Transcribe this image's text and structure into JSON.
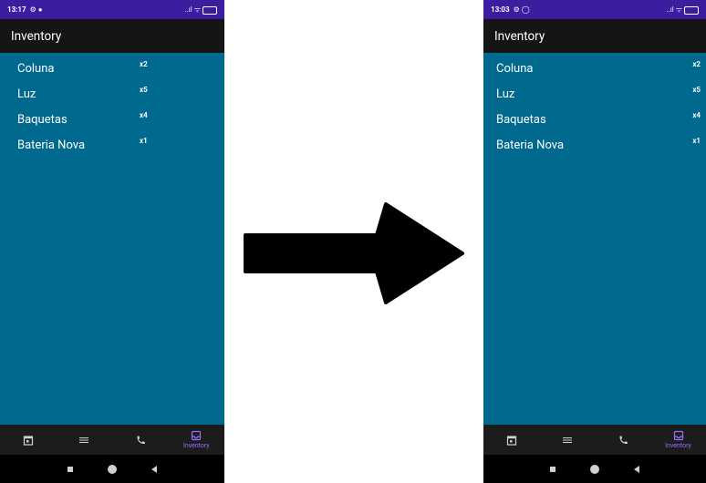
{
  "screens": [
    {
      "status": {
        "time": "13:17",
        "left_icons": "⚙ ●",
        "right_icons": "..ıl ᯤ",
        "battery": "61"
      },
      "title": "Inventory",
      "items": [
        {
          "name": "Coluna",
          "qty": "x2"
        },
        {
          "name": "Luz",
          "qty": "x5"
        },
        {
          "name": "Baquetas",
          "qty": "x4"
        },
        {
          "name": "Bateria Nova",
          "qty": "x1"
        }
      ],
      "nav": {
        "active_label": "Inventory"
      }
    },
    {
      "status": {
        "time": "13:03",
        "left_icons": "⚙ ◯",
        "right_icons": "..ıl ᯤ",
        "battery": "57"
      },
      "title": "Inventory",
      "items": [
        {
          "name": "Coluna",
          "qty": "x2"
        },
        {
          "name": "Luz",
          "qty": "x5"
        },
        {
          "name": "Baquetas",
          "qty": "x4"
        },
        {
          "name": "Bateria Nova",
          "qty": "x1"
        }
      ],
      "nav": {
        "active_label": "Inventory"
      }
    }
  ],
  "colors": {
    "status_bar": "#3b1ea0",
    "background": "#00698e",
    "app_bar": "#151515",
    "nav_active": "#9b6cff"
  }
}
